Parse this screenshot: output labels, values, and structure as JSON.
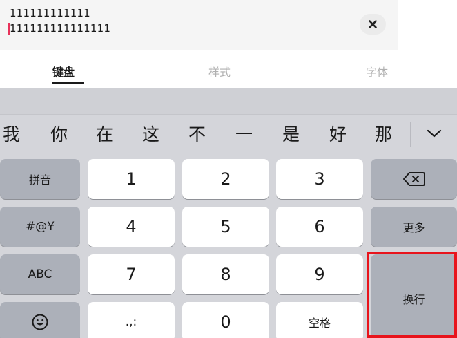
{
  "input": {
    "line1": "111111111111",
    "line2": "111111111111111",
    "clear_icon": "close-icon"
  },
  "tabs": [
    {
      "label": "键盘",
      "active": true
    },
    {
      "label": "样式",
      "active": false
    },
    {
      "label": "字体",
      "active": false
    }
  ],
  "candidates": [
    "我",
    "你",
    "在",
    "这",
    "不",
    "一",
    "是",
    "好",
    "那"
  ],
  "keys": {
    "left": [
      "拼音",
      "#@¥",
      "ABC"
    ],
    "digits": [
      "1",
      "2",
      "3",
      "4",
      "5",
      "6",
      "7",
      "8",
      "9"
    ],
    "punct": ".,:",
    "zero": "0",
    "space": "空格",
    "more": "更多",
    "enter": "换行"
  },
  "colors": {
    "highlight": "#e8141c",
    "caret": "#e8325a",
    "keyboard_bg": "#d4d5da",
    "dark_key": "#acb0b9"
  }
}
